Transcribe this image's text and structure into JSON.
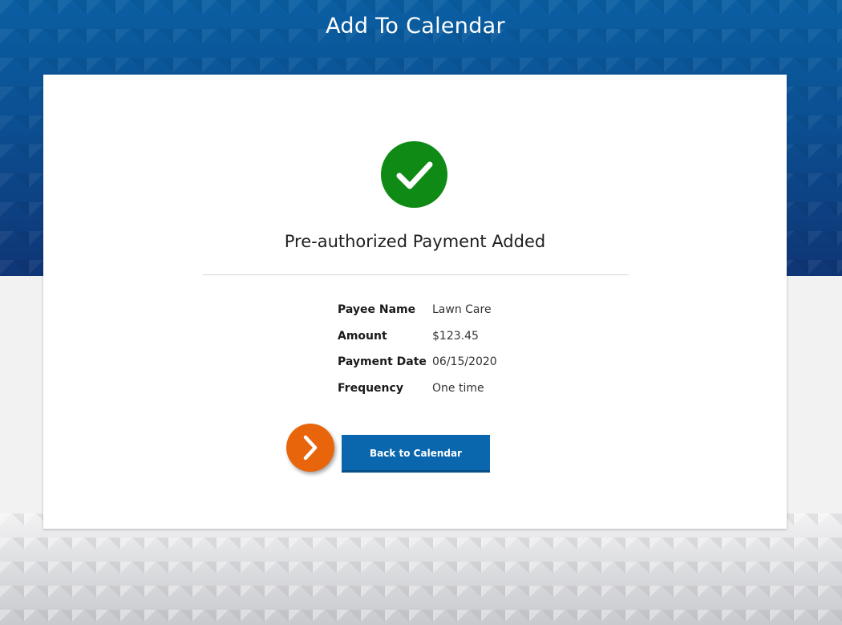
{
  "header": {
    "title": "Add To Calendar"
  },
  "confirmation": {
    "icon": "checkmark-circle-icon",
    "icon_color": "#0e8a15",
    "heading": "Pre-authorized Payment Added"
  },
  "details": [
    {
      "label": "Payee Name",
      "value": "Lawn Care"
    },
    {
      "label": "Amount",
      "value": "$123.45"
    },
    {
      "label": "Payment Date",
      "value": "06/15/2020"
    },
    {
      "label": "Frequency",
      "value": "One time"
    }
  ],
  "actions": {
    "back_label": "Back to Calendar",
    "back_color": "#0a66ad",
    "hint_icon": "chevron-right-icon",
    "hint_color": "#e8650c"
  }
}
